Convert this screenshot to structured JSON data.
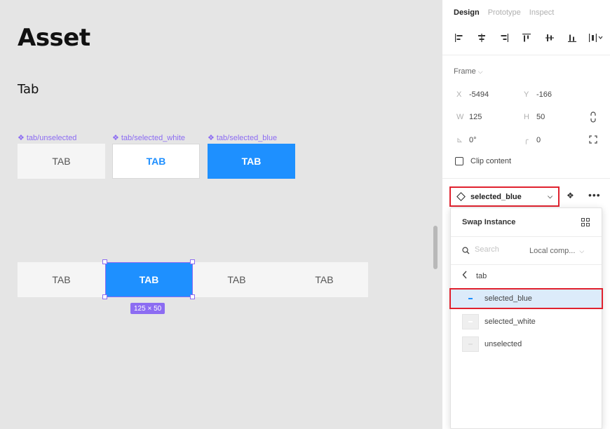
{
  "canvas": {
    "heading": "Asset",
    "subheading": "Tab",
    "components": [
      {
        "label": "tab/unselected",
        "tab_label": "TAB",
        "style": "unselected"
      },
      {
        "label": "tab/selected_white",
        "tab_label": "TAB",
        "style": "selected_white"
      },
      {
        "label": "tab/selected_blue",
        "tab_label": "TAB",
        "style": "selected_blue"
      }
    ],
    "tab_row": [
      "TAB",
      "TAB",
      "TAB",
      "TAB"
    ],
    "selected_index": 1,
    "size_badge": "125 × 50"
  },
  "panel": {
    "tabs": [
      {
        "label": "Design",
        "active": true
      },
      {
        "label": "Prototype",
        "active": false
      },
      {
        "label": "Inspect",
        "active": false
      }
    ],
    "align_icons": [
      "align-left-icon",
      "align-horizontal-center-icon",
      "align-right-icon",
      "align-top-icon",
      "align-vertical-center-icon",
      "align-bottom-icon",
      "distribute-icon"
    ],
    "frame": {
      "title": "Frame",
      "x_label": "X",
      "x": "-5494",
      "y_label": "Y",
      "y": "-166",
      "w_label": "W",
      "w": "125",
      "h_label": "H",
      "h": "50",
      "rotation": "0°",
      "radius": "0",
      "clip_content": "Clip content"
    },
    "instance": {
      "name": "selected_blue"
    },
    "swap": {
      "title": "Swap Instance",
      "search_placeholder": "Search",
      "scope": "Local comp...",
      "breadcrumb": "tab",
      "items": [
        {
          "label": "selected_blue",
          "selected": true,
          "color": "#1e90ff"
        },
        {
          "label": "selected_white",
          "selected": false,
          "color": "#ffffff"
        },
        {
          "label": "unselected",
          "selected": false,
          "color": "#e8e8e8"
        }
      ]
    }
  },
  "colors": {
    "accent_blue": "#1e90ff",
    "selection_purple": "#8c6cf2",
    "highlight_red": "#e0212e"
  }
}
